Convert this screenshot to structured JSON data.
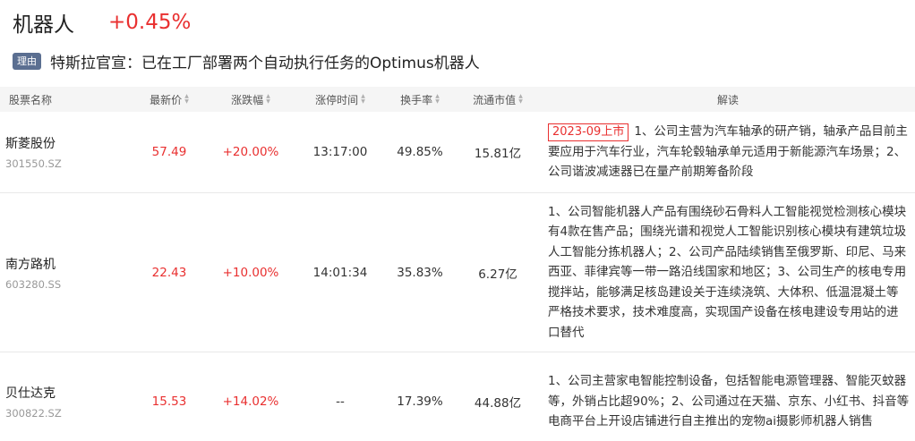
{
  "header": {
    "title": "机器人",
    "change": "+0.45%"
  },
  "reason": {
    "tag": "理由",
    "text": "特斯拉官宣：已在工厂部署两个自动执行任务的Optimus机器人"
  },
  "columns": {
    "name": "股票名称",
    "price": "最新价",
    "change": "涨跌幅",
    "limit_time": "涨停时间",
    "turnover": "换手率",
    "market_cap": "流通市值",
    "note": "解读"
  },
  "rows": [
    {
      "name": "斯菱股份",
      "code": "301550.SZ",
      "price": "57.49",
      "change": "+20.00%",
      "limit_time": "13:17:00",
      "turnover": "49.85%",
      "market_cap": "15.81亿",
      "badge": "2023-09上市",
      "note": "1、公司主营为汽车轴承的研产销，轴承产品目前主要应用于汽车行业，汽车轮毂轴承单元适用于新能源汽车场景；2、公司谐波减速器已在量产前期筹备阶段"
    },
    {
      "name": "南方路机",
      "code": "603280.SS",
      "price": "22.43",
      "change": "+10.00%",
      "limit_time": "14:01:34",
      "turnover": "35.83%",
      "market_cap": "6.27亿",
      "badge": "",
      "note": "1、公司智能机器人产品有围绕砂石骨料人工智能视觉检测核心模块有4款在售产品；围绕光谱和视觉人工智能识别核心模块有建筑垃圾人工智能分拣机器人；2、公司产品陆续销售至俄罗斯、印尼、马来西亚、菲律宾等一带一路沿线国家和地区；3、公司生产的核电专用搅拌站，能够满足核岛建设关于连续浇筑、大体积、低温混凝土等严格技术要求，技术难度高，实现国产设备在核电建设专用站的进口替代"
    },
    {
      "name": "贝仕达克",
      "code": "300822.SZ",
      "price": "15.53",
      "change": "+14.02%",
      "limit_time": "--",
      "turnover": "17.39%",
      "market_cap": "44.88亿",
      "badge": "",
      "note": "1、公司主营家电智能控制设备，包括智能电源管理器、智能灭蚊器等，外销占比超90%；2、公司通过在天猫、京东、小红书、抖音等电商平台上开设店铺进行自主推出的宠物ai摄影师机器人销售"
    }
  ],
  "colors": {
    "up": "#e93030",
    "tag_bg": "#5b6f91",
    "header_bg": "#f5f5f5"
  }
}
